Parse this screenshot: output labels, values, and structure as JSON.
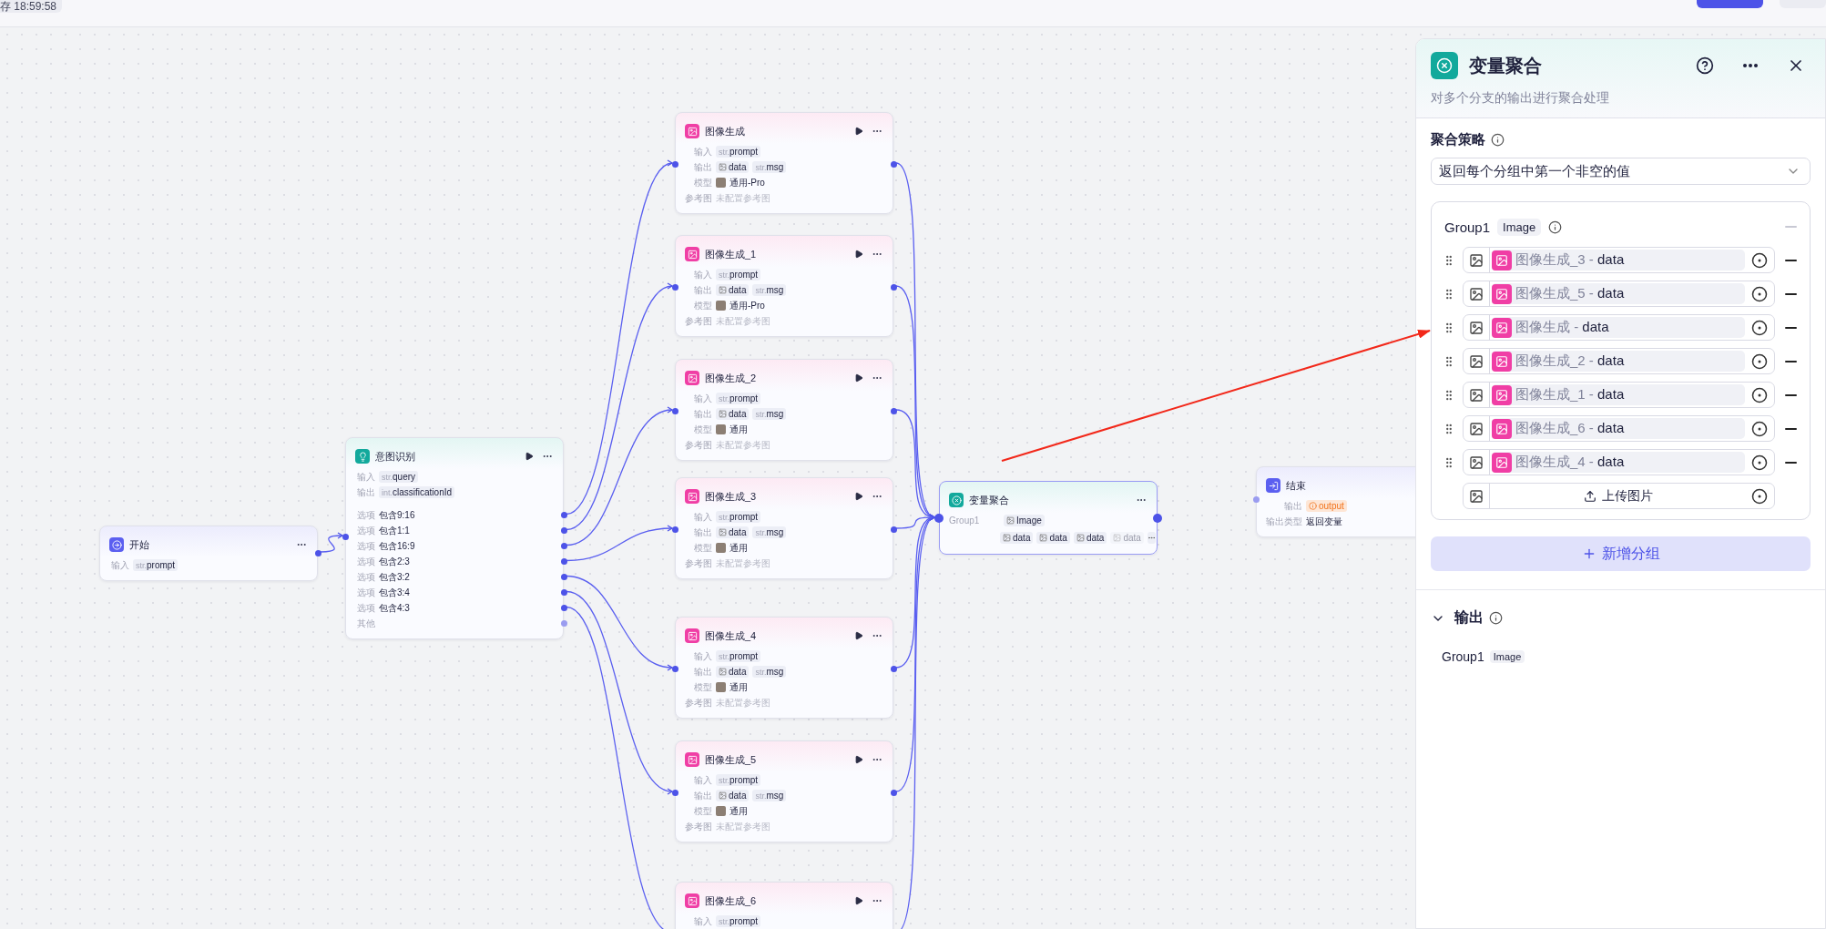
{
  "topbar": {
    "save_status": "存 18:59:58"
  },
  "canvas": {
    "start": {
      "title": "开始",
      "rows": [
        {
          "kind": "tags",
          "label": "输入",
          "tags": [
            {
              "kind": "str",
              "prefix": "str.",
              "name": "prompt"
            }
          ]
        }
      ]
    },
    "intent": {
      "title": "意图识别",
      "rows": [
        {
          "kind": "tags",
          "label": "输入",
          "tags": [
            {
              "kind": "str",
              "prefix": "str.",
              "name": "query"
            }
          ]
        },
        {
          "kind": "tags",
          "label": "输出",
          "tags": [
            {
              "kind": "str",
              "prefix": "int.",
              "name": "classificationId"
            }
          ]
        }
      ],
      "options": [
        {
          "label": "选项",
          "value": "包含9:16"
        },
        {
          "label": "选项",
          "value": "包含1:1"
        },
        {
          "label": "选项",
          "value": "包含16:9"
        },
        {
          "label": "选项",
          "value": "包含2:3"
        },
        {
          "label": "选项",
          "value": "包含3:2"
        },
        {
          "label": "选项",
          "value": "包含3:4"
        },
        {
          "label": "选项",
          "value": "包含4:3"
        }
      ],
      "other": "其他"
    },
    "image_nodes": [
      {
        "title": "图像生成",
        "rows": [
          {
            "kind": "tags",
            "label": "输入",
            "tags": [
              {
                "kind": "str",
                "prefix": "str.",
                "name": "prompt"
              }
            ]
          },
          {
            "kind": "tags",
            "label": "输出",
            "tags": [
              {
                "kind": "image",
                "name": "data"
              },
              {
                "kind": "str",
                "prefix": "str.",
                "name": "msg"
              }
            ]
          },
          {
            "kind": "model",
            "label": "模型",
            "value": "通用-Pro"
          },
          {
            "kind": "muted",
            "label": "参考图",
            "value": "未配置参考图"
          }
        ]
      },
      {
        "title": "图像生成_1",
        "rows": [
          {
            "kind": "tags",
            "label": "输入",
            "tags": [
              {
                "kind": "str",
                "prefix": "str.",
                "name": "prompt"
              }
            ]
          },
          {
            "kind": "tags",
            "label": "输出",
            "tags": [
              {
                "kind": "image",
                "name": "data"
              },
              {
                "kind": "str",
                "prefix": "str.",
                "name": "msg"
              }
            ]
          },
          {
            "kind": "model",
            "label": "模型",
            "value": "通用-Pro"
          },
          {
            "kind": "muted",
            "label": "参考图",
            "value": "未配置参考图"
          }
        ]
      },
      {
        "title": "图像生成_2",
        "rows": [
          {
            "kind": "tags",
            "label": "输入",
            "tags": [
              {
                "kind": "str",
                "prefix": "str.",
                "name": "prompt"
              }
            ]
          },
          {
            "kind": "tags",
            "label": "输出",
            "tags": [
              {
                "kind": "image",
                "name": "data"
              },
              {
                "kind": "str",
                "prefix": "str.",
                "name": "msg"
              }
            ]
          },
          {
            "kind": "model",
            "label": "模型",
            "value": "通用"
          },
          {
            "kind": "muted",
            "label": "参考图",
            "value": "未配置参考图"
          }
        ]
      },
      {
        "title": "图像生成_3",
        "rows": [
          {
            "kind": "tags",
            "label": "输入",
            "tags": [
              {
                "kind": "str",
                "prefix": "str.",
                "name": "prompt"
              }
            ]
          },
          {
            "kind": "tags",
            "label": "输出",
            "tags": [
              {
                "kind": "image",
                "name": "data"
              },
              {
                "kind": "str",
                "prefix": "str.",
                "name": "msg"
              }
            ]
          },
          {
            "kind": "model",
            "label": "模型",
            "value": "通用"
          },
          {
            "kind": "muted",
            "label": "参考图",
            "value": "未配置参考图"
          }
        ]
      },
      {
        "title": "图像生成_4",
        "rows": [
          {
            "kind": "tags",
            "label": "输入",
            "tags": [
              {
                "kind": "str",
                "prefix": "str.",
                "name": "prompt"
              }
            ]
          },
          {
            "kind": "tags",
            "label": "输出",
            "tags": [
              {
                "kind": "image",
                "name": "data"
              },
              {
                "kind": "str",
                "prefix": "str.",
                "name": "msg"
              }
            ]
          },
          {
            "kind": "model",
            "label": "模型",
            "value": "通用"
          },
          {
            "kind": "muted",
            "label": "参考图",
            "value": "未配置参考图"
          }
        ]
      },
      {
        "title": "图像生成_5",
        "rows": [
          {
            "kind": "tags",
            "label": "输入",
            "tags": [
              {
                "kind": "str",
                "prefix": "str.",
                "name": "prompt"
              }
            ]
          },
          {
            "kind": "tags",
            "label": "输出",
            "tags": [
              {
                "kind": "image",
                "name": "data"
              },
              {
                "kind": "str",
                "prefix": "str.",
                "name": "msg"
              }
            ]
          },
          {
            "kind": "model",
            "label": "模型",
            "value": "通用"
          },
          {
            "kind": "muted",
            "label": "参考图",
            "value": "未配置参考图"
          }
        ]
      },
      {
        "title": "图像生成_6",
        "rows": [
          {
            "kind": "tags",
            "label": "输入",
            "tags": [
              {
                "kind": "str",
                "prefix": "str.",
                "name": "prompt"
              }
            ]
          }
        ]
      }
    ],
    "aggregate": {
      "title": "变量聚合",
      "group": "Group1",
      "type": "Image",
      "vars": [
        {
          "name": "data",
          "faded": false
        },
        {
          "name": "data",
          "faded": false
        },
        {
          "name": "data",
          "faded": false
        },
        {
          "name": "data",
          "faded": true
        }
      ]
    },
    "end": {
      "title": "结束",
      "rows": [
        {
          "kind": "tags",
          "label": "输出",
          "tags": [
            {
              "kind": "warning",
              "name": "output"
            }
          ]
        },
        {
          "kind": "text",
          "label": "输出类型",
          "value": "返回变量"
        }
      ]
    }
  },
  "panel": {
    "title": "变量聚合",
    "description": "对多个分支的输出进行聚合处理",
    "strategy": {
      "label": "聚合策略",
      "value": "返回每个分组中第一个非空的值"
    },
    "groups": [
      {
        "name": "Group1",
        "type": "Image",
        "items": [
          {
            "source": "图像生成_3",
            "sep": "-",
            "variable": "data"
          },
          {
            "source": "图像生成_5",
            "sep": "-",
            "variable": "data"
          },
          {
            "source": "图像生成",
            "sep": "-",
            "variable": "data"
          },
          {
            "source": "图像生成_2",
            "sep": "-",
            "variable": "data"
          },
          {
            "source": "图像生成_1",
            "sep": "-",
            "variable": "data"
          },
          {
            "source": "图像生成_6",
            "sep": "-",
            "variable": "data"
          },
          {
            "source": "图像生成_4",
            "sep": "-",
            "variable": "data"
          }
        ],
        "upload": "上传图片"
      }
    ],
    "add_group": "新增分组",
    "output": {
      "label": "输出",
      "expanded": true,
      "items": [
        {
          "name": "Group1",
          "type": "Image"
        }
      ]
    }
  }
}
